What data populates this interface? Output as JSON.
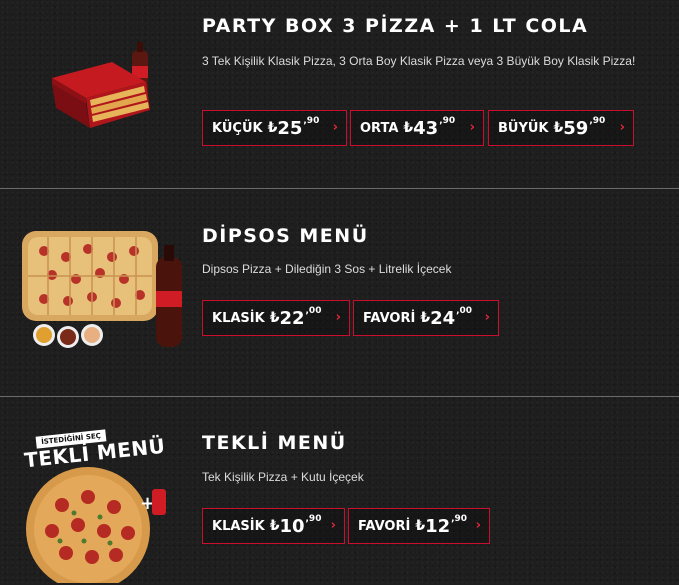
{
  "items": [
    {
      "title": "PARTY BOX 3 PİZZA + 1 LT COLA",
      "description": "3 Tek Kişilik Klasik Pizza, 3 Orta Boy Klasik Pizza veya 3 Büyük Boy Klasik Pizza!",
      "options": [
        {
          "label": "KÜÇÜK",
          "currency": "₺",
          "price_int": "25",
          "price_dec": ",90"
        },
        {
          "label": "ORTA",
          "currency": "₺",
          "price_int": "43",
          "price_dec": ",90"
        },
        {
          "label": "BÜYÜK",
          "currency": "₺",
          "price_int": "59",
          "price_dec": ",90"
        }
      ]
    },
    {
      "title": "DİPSOS MENÜ",
      "description": "Dipsos Pizza + Dilediğin 3 Sos + Litrelik İçecek",
      "options": [
        {
          "label": "KLASİK",
          "currency": "₺",
          "price_int": "22",
          "price_dec": ",00"
        },
        {
          "label": "FAVORİ",
          "currency": "₺",
          "price_int": "24",
          "price_dec": ",00"
        }
      ]
    },
    {
      "title": "TEKLİ MENÜ",
      "description": "Tek Kişilik Pizza + Kutu İçeçek",
      "image_badge_top": "İSTEDİĞİNİ SEÇ",
      "image_badge_main": "TEKLİ MENÜ",
      "options": [
        {
          "label": "KLASİK",
          "currency": "₺",
          "price_int": "10",
          "price_dec": ",90"
        },
        {
          "label": "FAVORİ",
          "currency": "₺",
          "price_int": "12",
          "price_dec": ",90"
        }
      ]
    }
  ],
  "icons": {
    "chevron": "chevron-right-icon",
    "currency": "lira-icon"
  },
  "colors": {
    "accent": "#c8102e",
    "background": "#1e1e1e",
    "divider": "#6a6a6a"
  }
}
